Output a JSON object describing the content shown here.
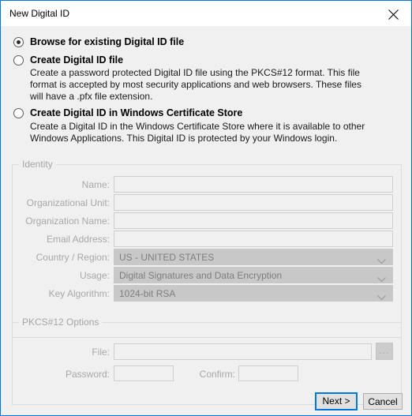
{
  "window": {
    "title": "New Digital ID",
    "close_icon": "close-icon",
    "accent_color": "#0078D7",
    "body_color": "#F0F0F0",
    "titlebar_color": "#FFFFFF"
  },
  "options": [
    {
      "label": "Browse for existing Digital ID file",
      "selected": true,
      "description": ""
    },
    {
      "label": "Create Digital ID file",
      "selected": false,
      "description": "Create a password protected Digital ID file using the PKCS#12 format. This file format is accepted by most security applications and web browsers. These files will have a .pfx file extension."
    },
    {
      "label": "Create Digital ID in Windows Certificate Store",
      "selected": false,
      "description": "Create a Digital ID in the Windows Certificate Store where it is available to other Windows Applications. This Digital ID is protected by your Windows login."
    }
  ],
  "identity": {
    "group_title": "Identity",
    "fields": [
      {
        "label": "Name:",
        "value": "",
        "type": "text"
      },
      {
        "label": "Organizational Unit:",
        "value": "",
        "type": "text"
      },
      {
        "label": "Organization Name:",
        "value": "",
        "type": "text"
      },
      {
        "label": "Email Address:",
        "value": "",
        "type": "text"
      },
      {
        "label": "Country / Region:",
        "value": "US - UNITED STATES",
        "type": "combo"
      },
      {
        "label": "Usage:",
        "value": "Digital Signatures and Data Encryption",
        "type": "combo"
      },
      {
        "label": "Key Algorithm:",
        "value": "1024-bit RSA",
        "type": "combo"
      }
    ]
  },
  "pkcs12": {
    "group_title": "PKCS#12 Options",
    "file_label": "File:",
    "file_value": "",
    "browse_label": "...",
    "password_label": "Password:",
    "password_value": "",
    "confirm_label": "Confirm:",
    "confirm_value": ""
  },
  "buttons": {
    "next_label": "Next >",
    "cancel_label": "Cancel"
  }
}
